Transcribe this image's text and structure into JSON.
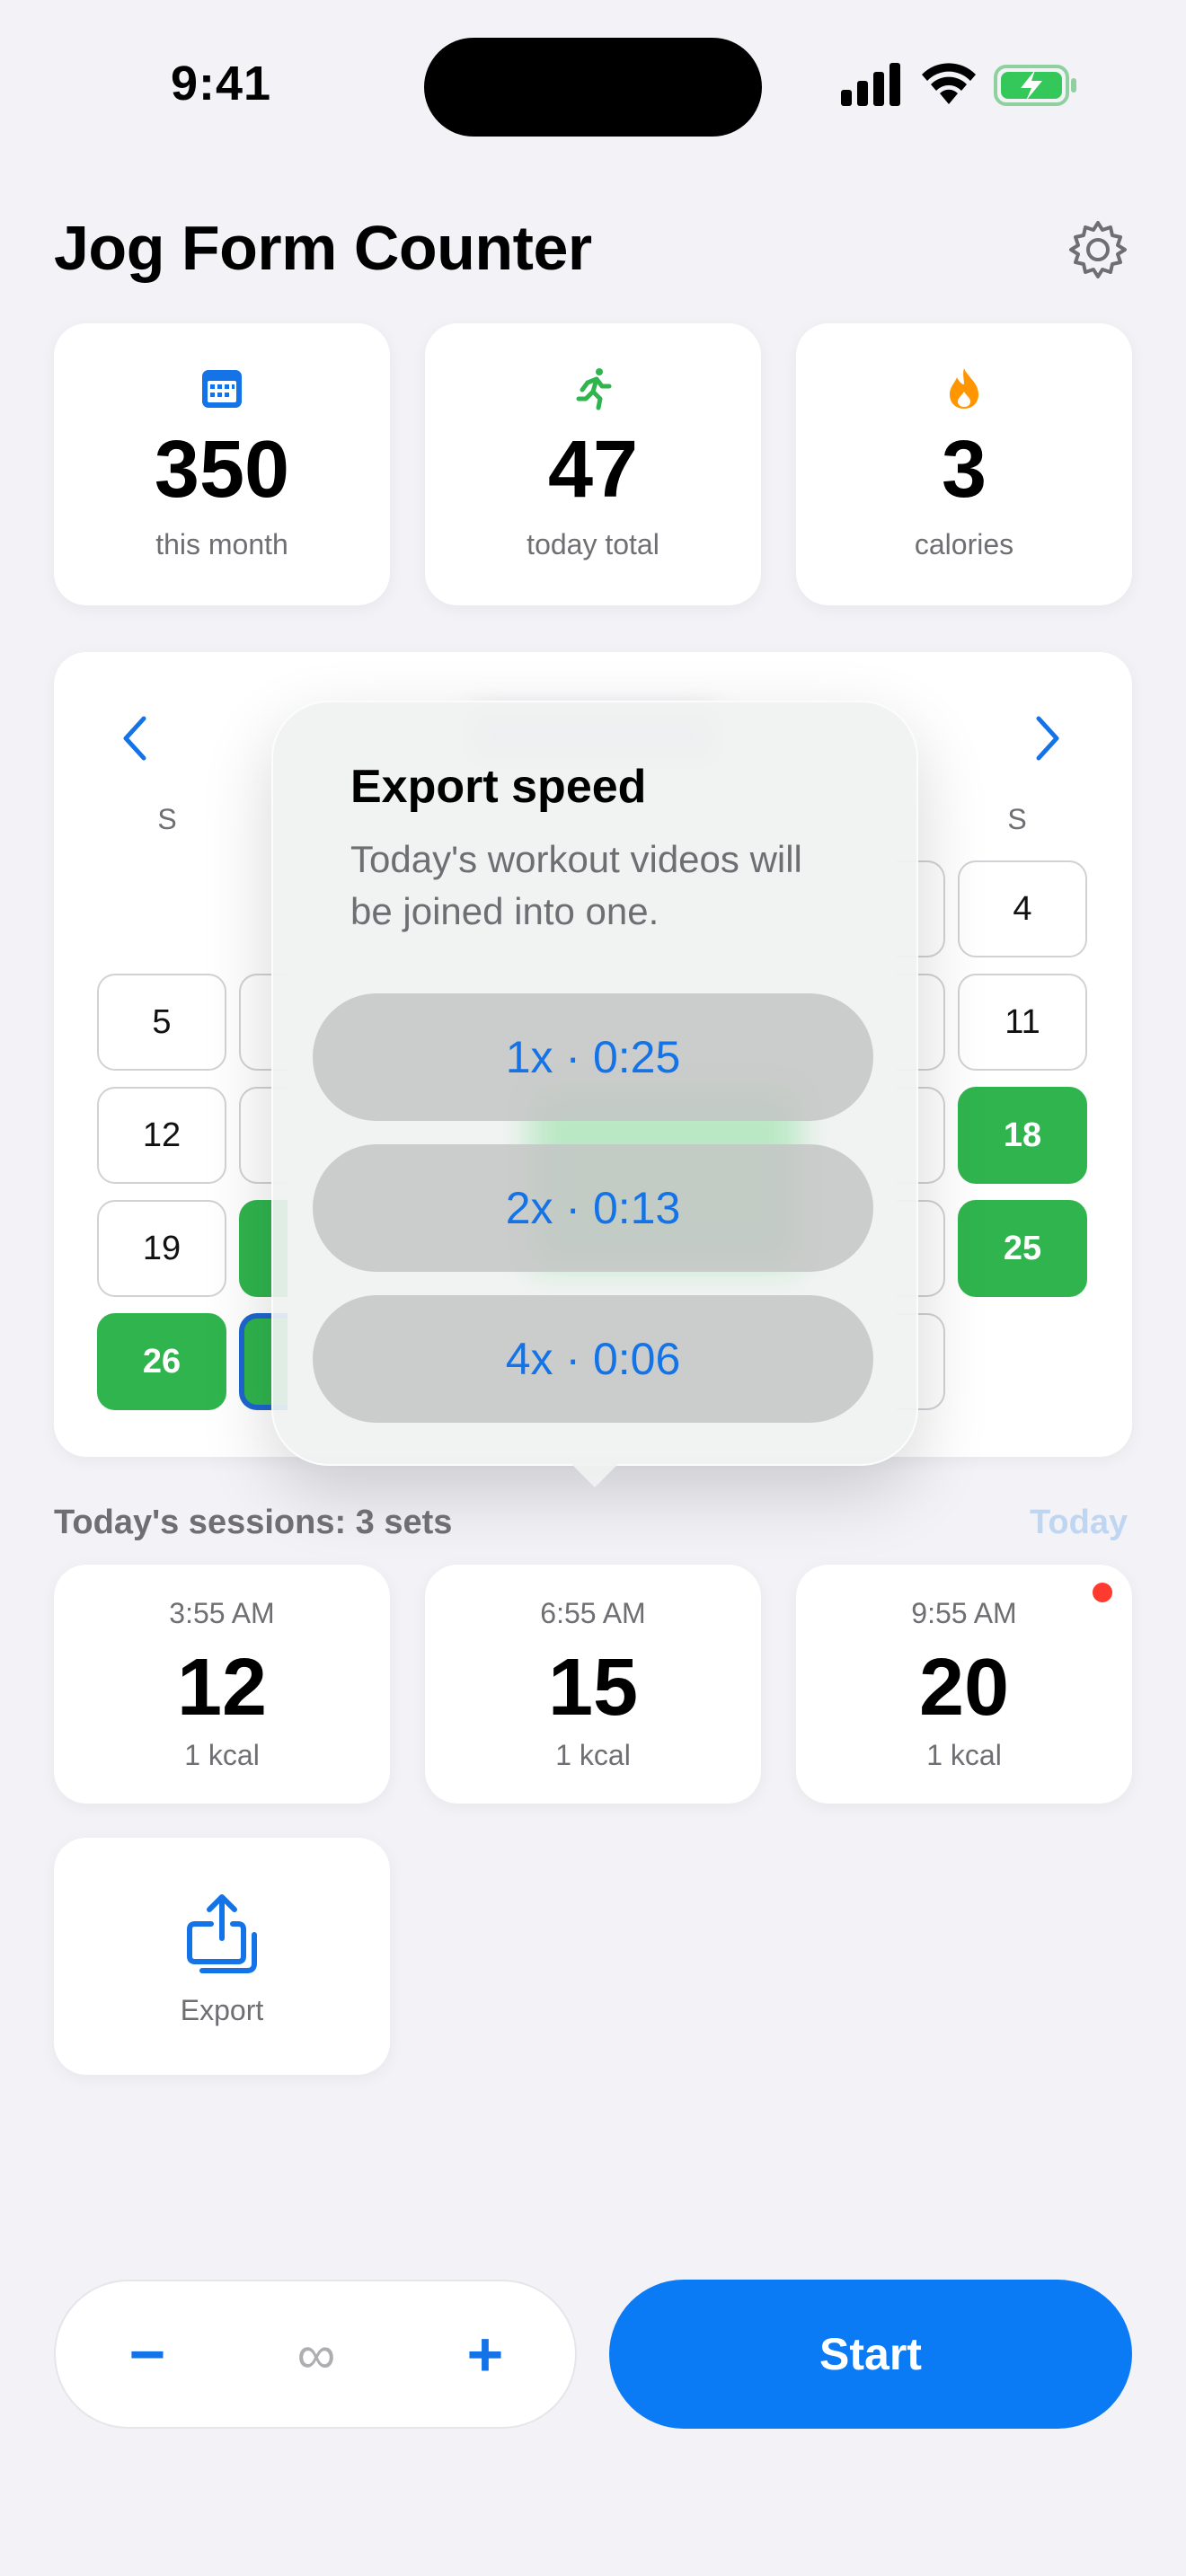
{
  "status_bar": {
    "time": "9:41"
  },
  "header": {
    "title": "Jog Form Counter"
  },
  "stats": [
    {
      "value": "350",
      "label": "this month",
      "icon": "calendar-icon"
    },
    {
      "value": "47",
      "label": "today total",
      "icon": "runner-icon"
    },
    {
      "value": "3",
      "label": "calories",
      "icon": "flame-icon"
    }
  ],
  "calendar": {
    "weekdays": {
      "first": "S",
      "last": "S"
    },
    "days": [
      "4",
      "5",
      "11",
      "12",
      "18",
      "19",
      "25",
      "26"
    ]
  },
  "popover": {
    "title": "Export speed",
    "message": "Today's workout videos will be joined into one.",
    "options": [
      "1x · 0:25",
      "2x · 0:13",
      "4x · 0:06"
    ]
  },
  "sessions": {
    "title": "Today's sessions: 3 sets",
    "today_link": "Today",
    "items": [
      {
        "time": "3:55 AM",
        "count": "12",
        "kcal": "1 kcal"
      },
      {
        "time": "6:55 AM",
        "count": "15",
        "kcal": "1 kcal"
      },
      {
        "time": "9:55 AM",
        "count": "20",
        "kcal": "1 kcal"
      }
    ]
  },
  "export": {
    "label": "Export"
  },
  "controls": {
    "minus": "−",
    "value": "∞",
    "plus": "+",
    "start": "Start"
  },
  "colors": {
    "accent": "#0A7AF5",
    "green": "#30B54E",
    "background": "#F2F2F7"
  }
}
